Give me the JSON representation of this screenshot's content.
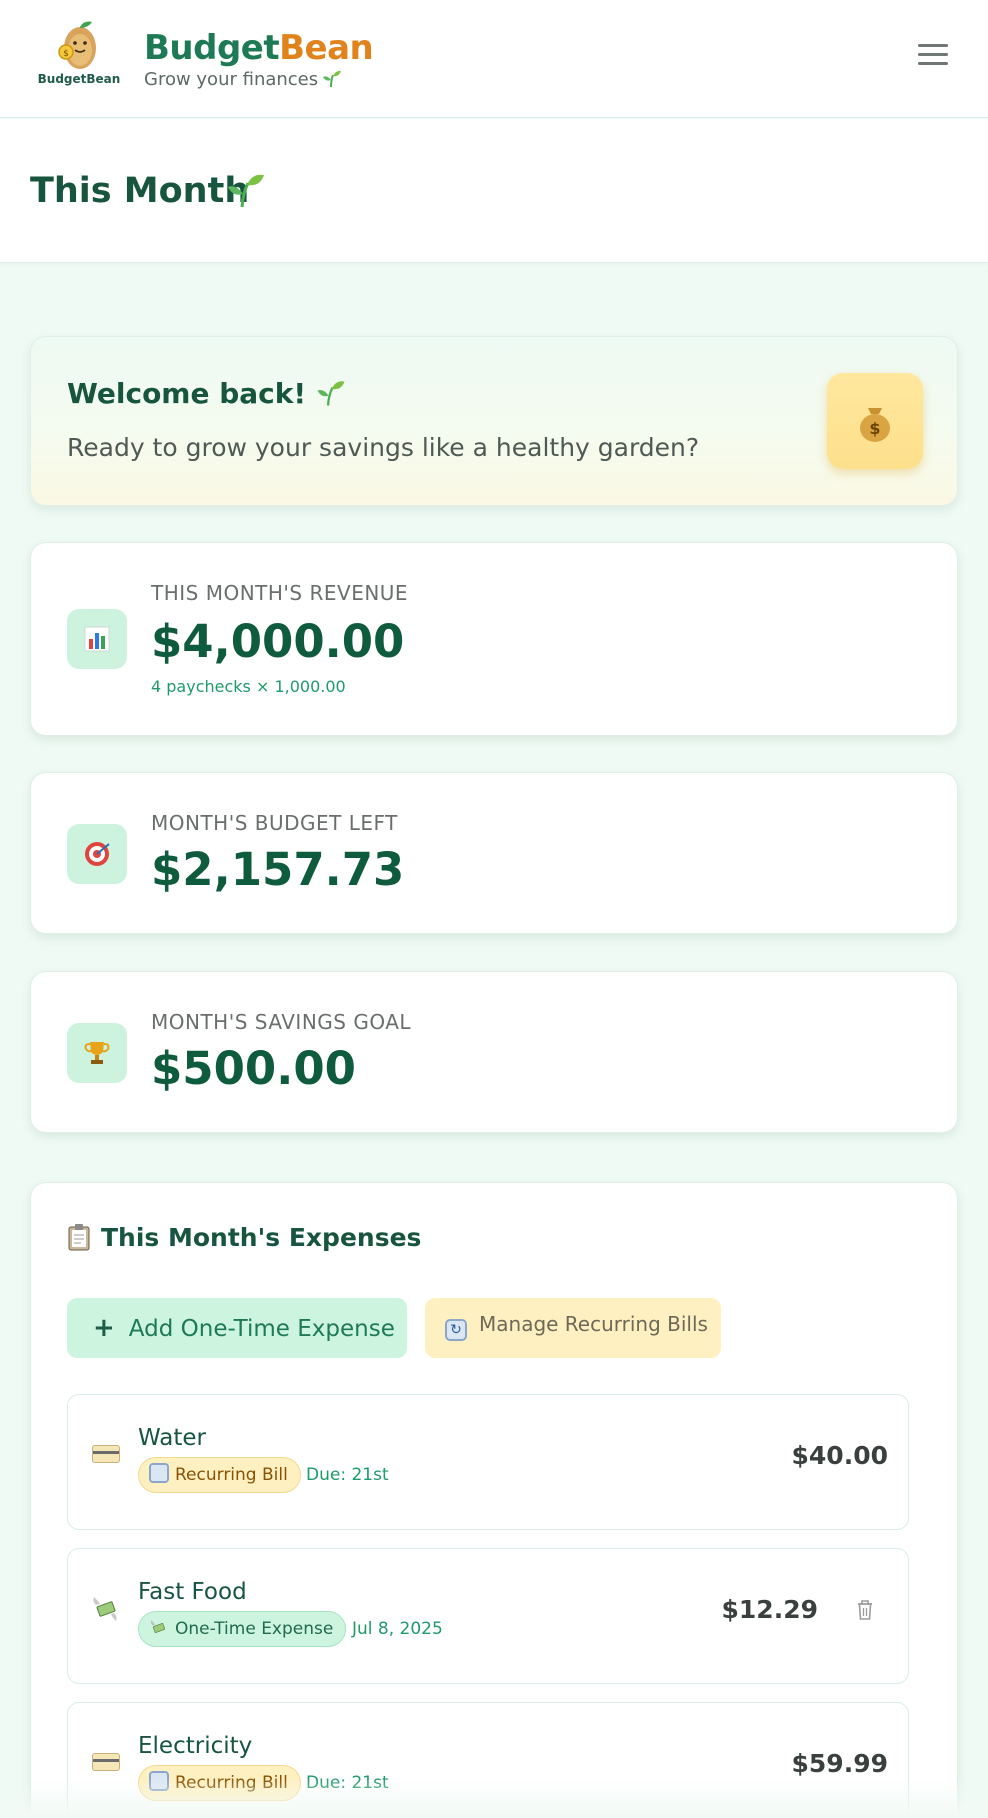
{
  "header": {
    "logo_text": "BudgetBean",
    "brand_part1": "Budget",
    "brand_part2": "Bean",
    "tagline": "Grow your finances",
    "menu_icon": "hamburger-icon"
  },
  "page": {
    "title": "This Month"
  },
  "welcome": {
    "title": "Welcome back!",
    "subtitle": "Ready to grow your savings like a healthy garden?",
    "icon": "money-bag-icon"
  },
  "revenue": {
    "label": "THIS MONTH'S REVENUE",
    "value": "$4,000.00",
    "sub": "4 paychecks × 1,000.00",
    "icon": "bar-chart-icon"
  },
  "budget": {
    "label": "MONTH'S BUDGET LEFT",
    "value": "$2,157.73",
    "icon": "target-icon"
  },
  "savings": {
    "label": "MONTH'S SAVINGS GOAL",
    "value": "$500.00",
    "icon": "trophy-icon"
  },
  "expenses": {
    "title": "This Month's Expenses",
    "add_label": "Add One-Time Expense",
    "manage_label": "Manage Recurring Bills",
    "items": [
      {
        "name": "Water",
        "badge": "Recurring Bill",
        "meta": "Due: 21st",
        "amount": "$40.00"
      },
      {
        "name": "Fast Food",
        "badge": "One-Time Expense",
        "meta": "Jul 8, 2025",
        "amount": "$12.29"
      },
      {
        "name": "Electricity",
        "badge": "Recurring Bill",
        "meta": "Due: 21st",
        "amount": "$59.99"
      }
    ]
  },
  "colors": {
    "brand_green": "#1d7a55",
    "brand_orange": "#e0831d",
    "background": "#effaf4"
  }
}
